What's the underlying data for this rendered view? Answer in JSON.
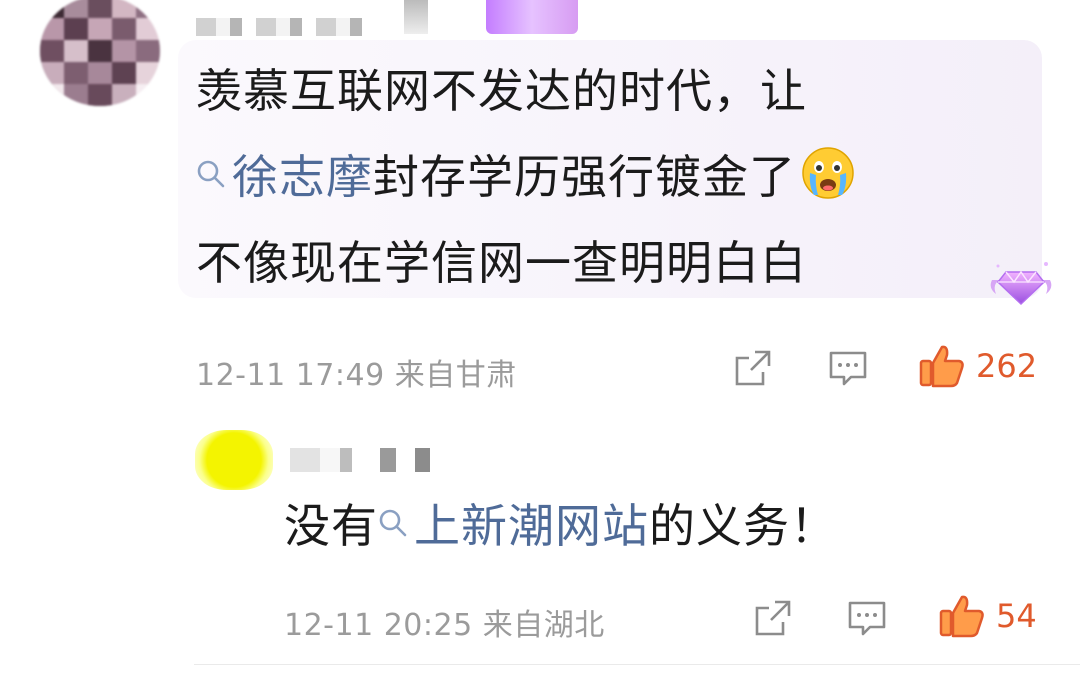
{
  "comment": {
    "lines": [
      {
        "text": "羡慕互联网不发达的时代，让"
      },
      {
        "link": "徐志摩",
        "rest": "封存学历强行镀金了"
      },
      {
        "text": "不像现在学信网一查明明白白"
      }
    ],
    "emoji_icon": "crying-face-emoji",
    "badge_icon": "purple-diamond-vip-badge",
    "timestamp": "12-11 17:49",
    "location": "来自甘肃",
    "like_count": "262"
  },
  "reply": {
    "prefix": "没有",
    "link": "上新潮网站",
    "suffix": "的义务！",
    "timestamp": "12-11 20:25",
    "location": "来自湖北",
    "like_count": "54"
  },
  "icons": {
    "share": "share-icon",
    "comment": "comment-icon",
    "like": "thumbs-up-icon",
    "search": "search-icon"
  },
  "colors": {
    "link": "#4f6b98",
    "like": "#e05a2c",
    "meta": "#9b9b9b",
    "bubble": "#f6f1fa"
  }
}
